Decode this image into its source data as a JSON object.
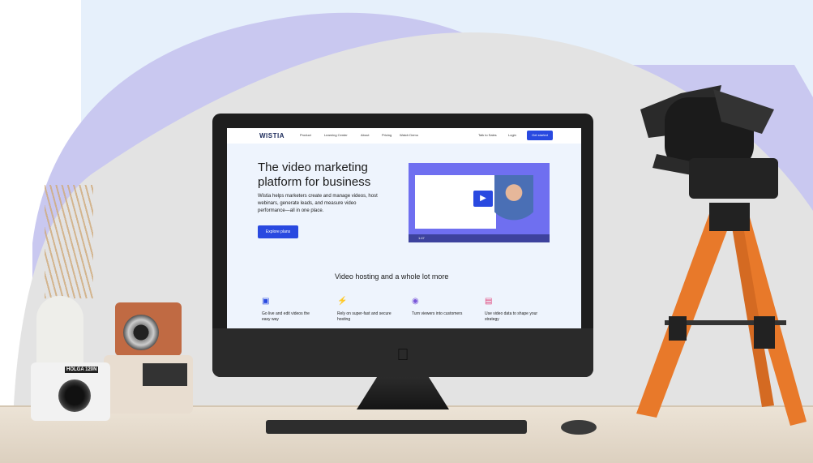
{
  "website": {
    "brand": "WISTIA",
    "nav_links": [
      "Product",
      "Learning Center",
      "About",
      "Pricing",
      "Watch Demo"
    ],
    "nav_right": [
      "Talk to Sales",
      "Login"
    ],
    "cta_nav": "Get started",
    "hero_title": "The video marketing platform for business",
    "hero_body": "Wistia helps marketers create and manage videos, host webinars, generate leads, and measure video performance—all in one place.",
    "hero_button": "Explore plans",
    "video_time": "1:47",
    "section_title": "Video hosting and a whole lot more",
    "features": [
      {
        "icon": "camera-icon",
        "color": "#2949e0",
        "text": "Go live and edit videos the easy way"
      },
      {
        "icon": "lightning-icon",
        "color": "#1aa36a",
        "text": "Rely on super-fast and secure hosting"
      },
      {
        "icon": "eye-icon",
        "color": "#7a57d9",
        "text": "Turn viewers into customers"
      },
      {
        "icon": "bar-chart-icon",
        "color": "#e0457b",
        "text": "Use video data to shape your strategy"
      }
    ]
  },
  "props": {
    "camera_label": "HOLGA 120N"
  },
  "colors": {
    "brand_blue": "#2949e0",
    "backdrop_lavender": "#c9c8f0",
    "backdrop_grey": "#e3e3e3",
    "tripod_orange": "#e8792a"
  }
}
